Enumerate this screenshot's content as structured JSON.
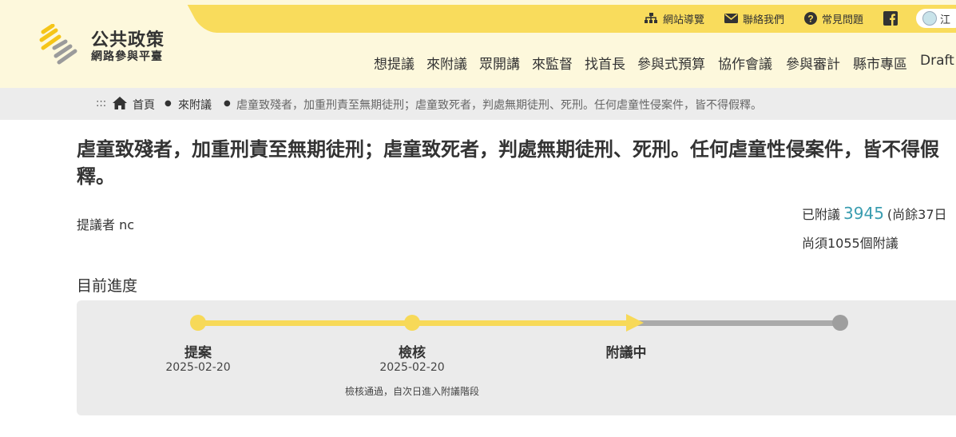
{
  "header": {
    "logo_title": "公共政策",
    "logo_subtitle": "網路參與平臺",
    "utility": {
      "sitemap": "網站導覽",
      "contact": "聯絡我們",
      "faq": "常見問題",
      "language": "江"
    },
    "nav": [
      "想提議",
      "來附議",
      "眾開講",
      "來監督",
      "找首長",
      "參與式預算",
      "協作會議",
      "參與審計",
      "縣市專區",
      "Draft"
    ]
  },
  "breadcrumb": {
    "dots": ":::",
    "home": "首頁",
    "category": "來附議",
    "current": "虐童致殘者，加重刑責至無期徒刑；虐童致死者，判處無期徒刑、死刑。任何虐童性侵案件，皆不得假釋。"
  },
  "proposal": {
    "title": "虐童致殘者，加重刑責至無期徒刑；虐童致死者，判處無期徒刑、死刑。任何虐童性侵案件，皆不得假釋。",
    "proposer": "提議者 nc",
    "endorsed_label": "已附議",
    "endorsed_count": "3945",
    "remaining_days": "(尚餘37日",
    "needed": "尚須1055個附議"
  },
  "progress": {
    "label": "目前進度",
    "fraction_complete": 0.67,
    "steps": [
      {
        "name": "提案",
        "date": "2025-02-20",
        "note": ""
      },
      {
        "name": "檢核",
        "date": "2025-02-20",
        "note": "檢核通過，自次日進入附議階段"
      },
      {
        "name": "附議中",
        "date": "",
        "note": ""
      },
      {
        "name": "",
        "date": "",
        "note": ""
      }
    ]
  },
  "colors": {
    "header_bg": "#fdf8dc",
    "accent_yellow": "#f9dc5c",
    "count_teal": "#3a9db0",
    "track_gray": "#aaaaaa"
  }
}
